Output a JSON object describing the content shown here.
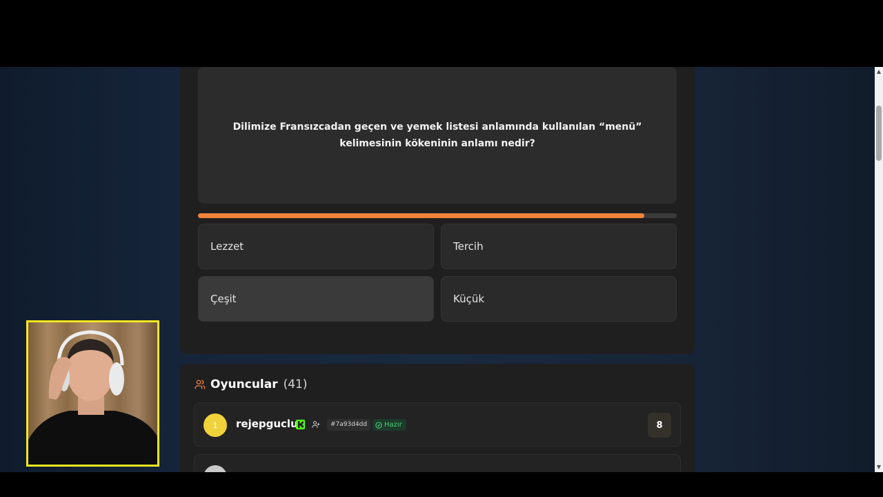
{
  "question": {
    "text": "Dilimize Fransızcadan geçen ve yemek listesi anlamında kullanılan “menü” kelimesinin kökeninin anlamı nedir?"
  },
  "timer": {
    "progress_fraction": 0.932
  },
  "answers": [
    {
      "label": "Lezzet"
    },
    {
      "label": "Tercih"
    },
    {
      "label": "Çeşit"
    },
    {
      "label": "Küçük"
    }
  ],
  "players": {
    "title": "Oyuncular",
    "count": "(41)",
    "rows": [
      {
        "rank": "1",
        "name": "rejepguclu",
        "id": "#7a93d4dd",
        "status": "Hazır",
        "score": "8"
      }
    ]
  },
  "colors": {
    "accent": "#f0823a",
    "webcam_border": "#f5e71f",
    "kick_green": "#53fc18",
    "ready_green": "#4cd07d"
  },
  "icons": [
    "users-icon",
    "kick-icon",
    "follow-icon",
    "check-circle-icon"
  ]
}
